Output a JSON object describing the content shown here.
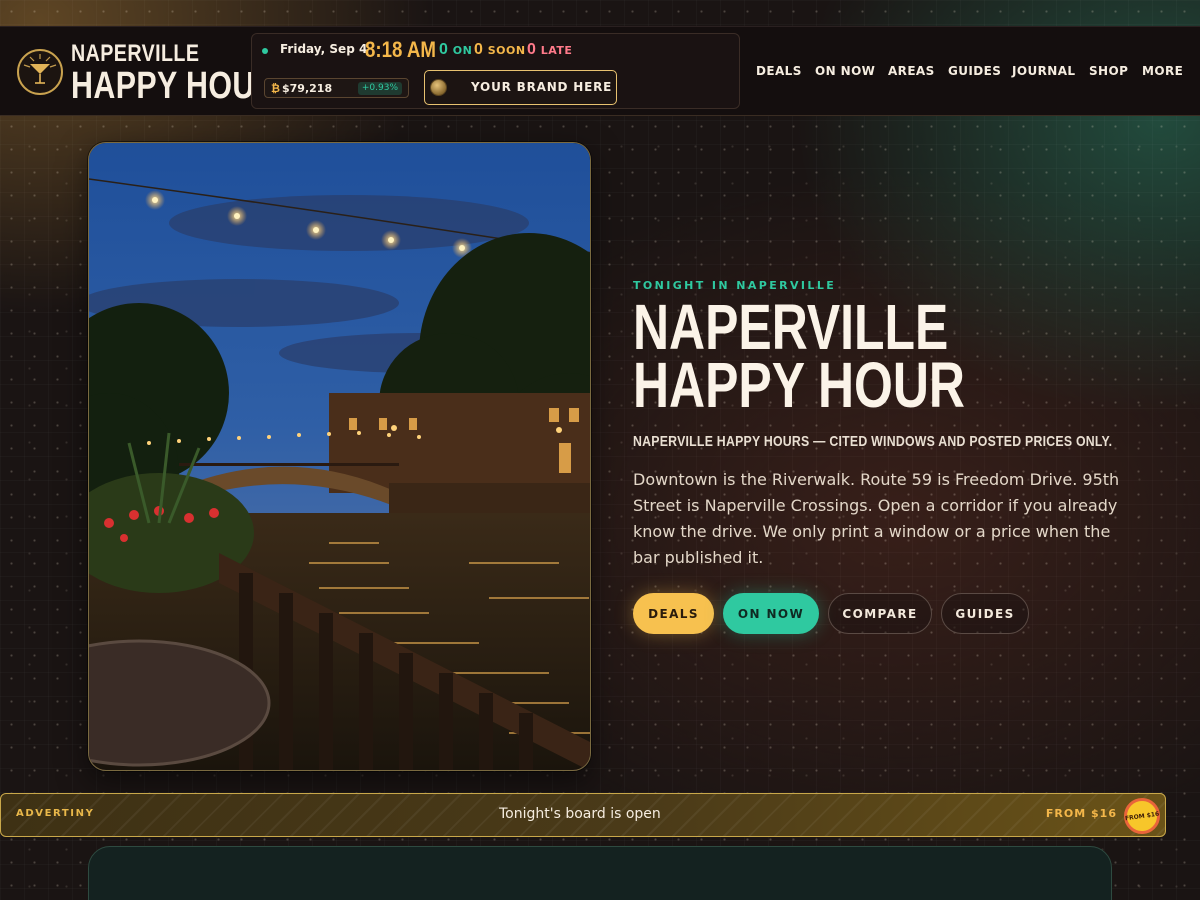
{
  "brand": {
    "line1": "NAPERVILLE",
    "line2": "HAPPY HOUR"
  },
  "ticker": {
    "date": "Friday, Sep 4",
    "time": "8:18 AM",
    "on": {
      "count": "0",
      "label": "ON"
    },
    "soon": {
      "count": "0",
      "label": "SOON"
    },
    "late": {
      "count": "0",
      "label": "LATE"
    },
    "price_symbol": "₿",
    "price": "$79,218",
    "price_change": "+0.93%",
    "brand_button": "YOUR BRAND HERE"
  },
  "nav": [
    "DEALS",
    "ON NOW",
    "AREAS",
    "GUIDES",
    "JOURNAL",
    "SHOP",
    "MORE"
  ],
  "hero": {
    "kicker": "TONIGHT IN NAPERVILLE",
    "title": "NAPERVILLE HAPPY HOUR",
    "subtitle": "NAPERVILLE HAPPY HOURS — CITED WINDOWS AND POSTED PRICES ONLY.",
    "body": "Downtown is the Riverwalk. Route 59 is Freedom Drive. 95th Street is Naperville Crossings. Open a corridor if you already know the drive. We only print a window or a price when the bar published it.",
    "buttons": [
      "DEALS",
      "ON NOW",
      "COMPARE",
      "GUIDES"
    ]
  },
  "ad": {
    "tag": "ADVERTINY",
    "text": "Tonight's board is open",
    "price": "FROM $16",
    "badge": "FROM $16"
  },
  "colors": {
    "accent_gold": "#f7c14f",
    "accent_teal": "#2fc9a0",
    "accent_pink": "#ff7a8a",
    "background": "#1a1413"
  }
}
